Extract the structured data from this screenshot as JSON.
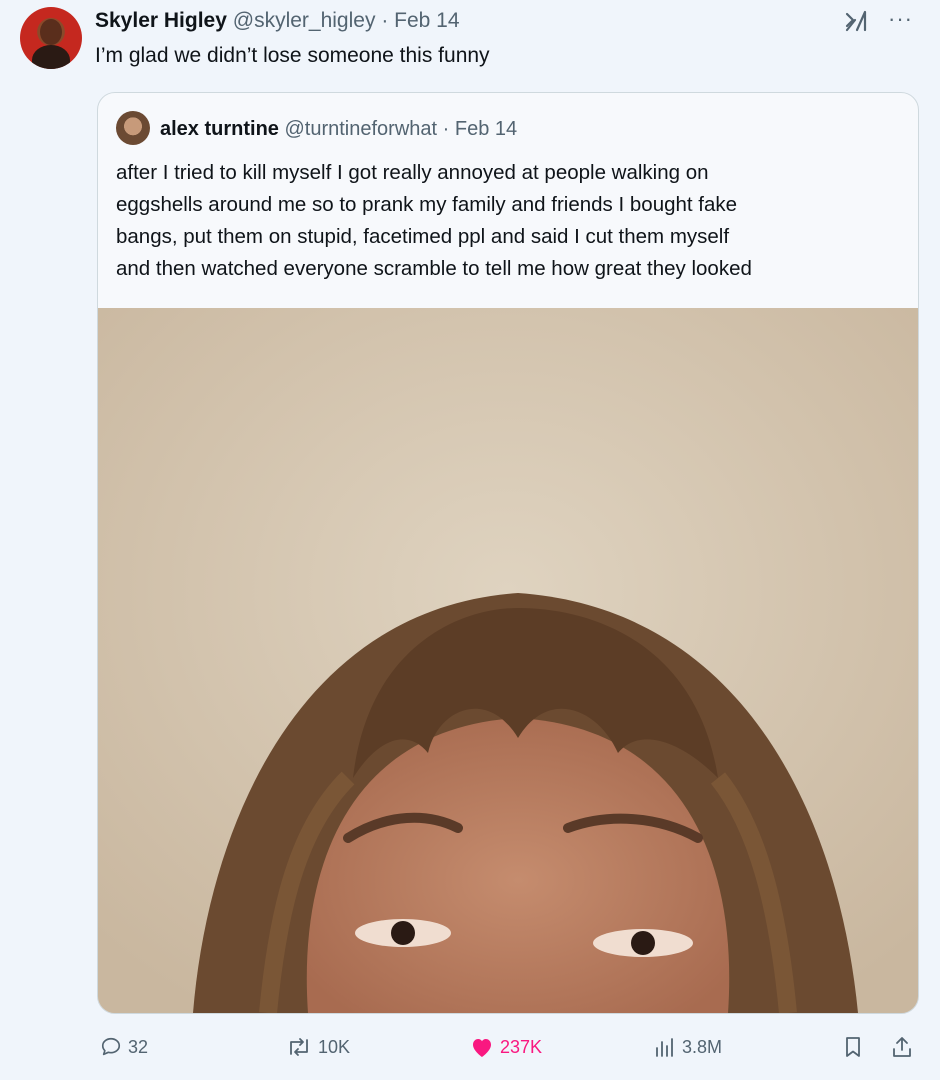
{
  "tweet": {
    "author_name": "Skyler Higley",
    "handle": "@skyler_higley",
    "separator": "·",
    "date": "Feb 14",
    "text": "I’m glad we didn’t lose someone this funny"
  },
  "quote": {
    "author_name": "alex turntine",
    "handle": "@turntineforwhat",
    "separator": "·",
    "date": "Feb 14",
    "lines": [
      "after I tried to kill myself I got really annoyed at people walking on",
      "eggshells around me so to prank my family and friends I bought fake",
      "bangs, put them on stupid, facetimed ppl and said I cut them myself",
      "and then watched everyone scramble to tell me how great they looked"
    ]
  },
  "actions": {
    "replies": "32",
    "reposts": "10K",
    "likes": "237K",
    "views": "3.8M"
  },
  "icons": {
    "reply": "reply-icon",
    "repost": "repost-icon",
    "like": "heart-icon",
    "views": "views-icon",
    "bookmark": "bookmark-icon",
    "share": "share-icon",
    "grok": "grok-icon",
    "more": "more-icon"
  },
  "colors": {
    "like": "#f91880",
    "muted": "#536471",
    "background": "#f0f5fb"
  }
}
